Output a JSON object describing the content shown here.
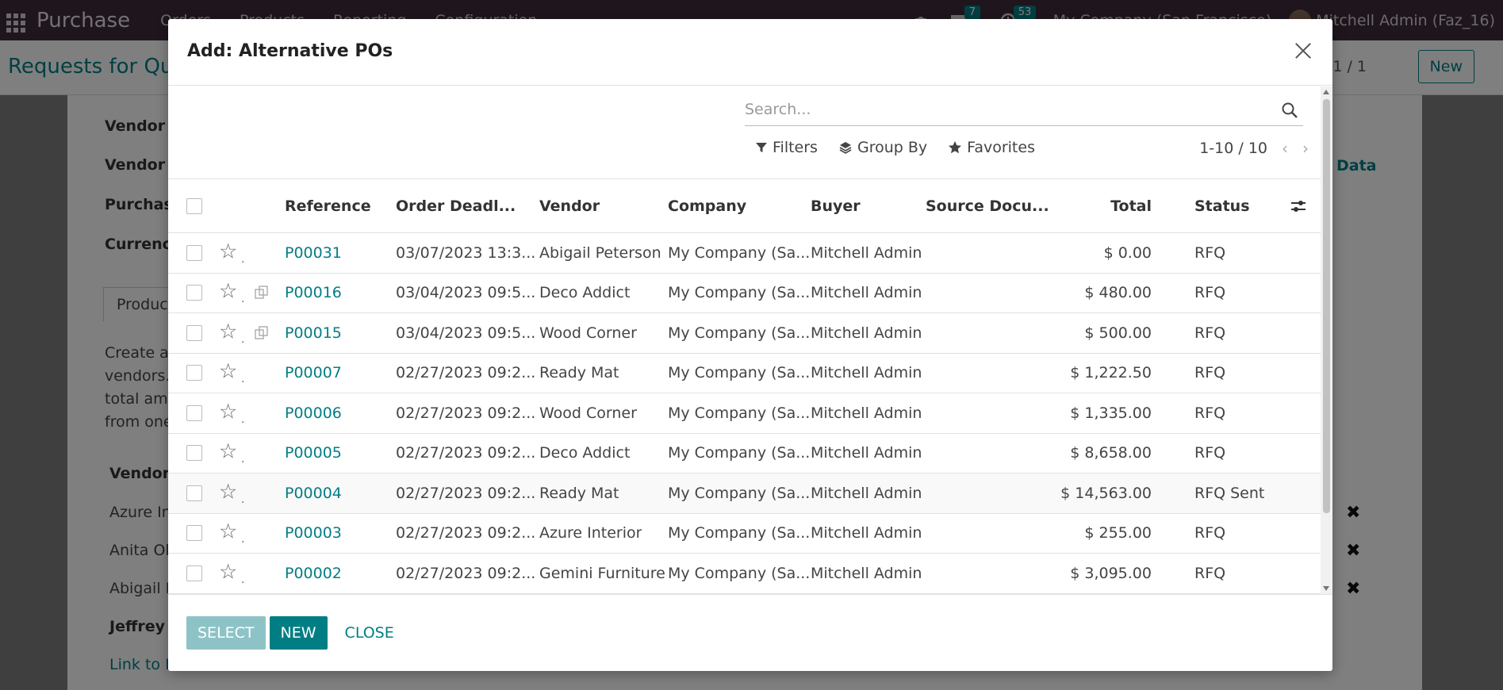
{
  "app": {
    "brand": "Purchase",
    "menu": [
      "Orders",
      "Products",
      "Reporting",
      "Configuration"
    ],
    "messages_count": "7",
    "activities_count": "53",
    "company": "My Company (San Francisco)",
    "user": "Mitchell Admin (Faz_16)"
  },
  "background": {
    "title": "Requests for Quo",
    "pager": "1 / 1",
    "new_label": "New",
    "fields": [
      "Vendor",
      "Vendor R",
      "Purchase",
      "Currency"
    ],
    "tab_label": "Produc",
    "data_link": "Data",
    "help_lines": [
      "Create a",
      "vendors.",
      "total amo",
      "from one"
    ],
    "vendor_header": "Vendor",
    "vendor_rows": [
      "Azure In",
      "Anita Ol",
      "Abigail P",
      "Jeffrey"
    ],
    "link_text": "Link to E"
  },
  "modal": {
    "title": "Add: Alternative POs",
    "search_placeholder": "Search...",
    "filters_label": "Filters",
    "groupby_label": "Group By",
    "favorites_label": "Favorites",
    "pager": "1-10 / 10",
    "columns": {
      "reference": "Reference",
      "deadline": "Order Deadl...",
      "vendor": "Vendor",
      "company": "Company",
      "buyer": "Buyer",
      "source": "Source Docu...",
      "total": "Total",
      "status": "Status"
    },
    "rows": [
      {
        "reference": "P00031",
        "deadline": "03/07/2023 13:3...",
        "vendor": "Abigail Peterson",
        "company": "My Company (Sa...",
        "buyer": "Mitchell Admin",
        "total": "$ 0.00",
        "status": "RFQ"
      },
      {
        "reference": "P00016",
        "deadline": "03/04/2023 09:5...",
        "vendor": "Deco Addict",
        "company": "My Company (Sa...",
        "buyer": "Mitchell Admin",
        "total": "$ 480.00",
        "status": "RFQ"
      },
      {
        "reference": "P00015",
        "deadline": "03/04/2023 09:5...",
        "vendor": "Wood Corner",
        "company": "My Company (Sa...",
        "buyer": "Mitchell Admin",
        "total": "$ 500.00",
        "status": "RFQ"
      },
      {
        "reference": "P00007",
        "deadline": "02/27/2023 09:2...",
        "vendor": "Ready Mat",
        "company": "My Company (Sa...",
        "buyer": "Mitchell Admin",
        "total": "$ 1,222.50",
        "status": "RFQ"
      },
      {
        "reference": "P00006",
        "deadline": "02/27/2023 09:2...",
        "vendor": "Wood Corner",
        "company": "My Company (Sa...",
        "buyer": "Mitchell Admin",
        "total": "$ 1,335.00",
        "status": "RFQ"
      },
      {
        "reference": "P00005",
        "deadline": "02/27/2023 09:2...",
        "vendor": "Deco Addict",
        "company": "My Company (Sa...",
        "buyer": "Mitchell Admin",
        "total": "$ 8,658.00",
        "status": "RFQ"
      },
      {
        "reference": "P00004",
        "deadline": "02/27/2023 09:2...",
        "vendor": "Ready Mat",
        "company": "My Company (Sa...",
        "buyer": "Mitchell Admin",
        "total": "$ 14,563.00",
        "status": "RFQ Sent"
      },
      {
        "reference": "P00003",
        "deadline": "02/27/2023 09:2...",
        "vendor": "Azure Interior",
        "company": "My Company (Sa...",
        "buyer": "Mitchell Admin",
        "total": "$ 255.00",
        "status": "RFQ"
      },
      {
        "reference": "P00002",
        "deadline": "02/27/2023 09:2...",
        "vendor": "Gemini Furniture",
        "company": "My Company (Sa...",
        "buyer": "Mitchell Admin",
        "total": "$ 3,095.00",
        "status": "RFQ"
      }
    ],
    "footer": {
      "select_label": "SELECT",
      "new_label": "NEW",
      "close_label": "CLOSE"
    }
  }
}
